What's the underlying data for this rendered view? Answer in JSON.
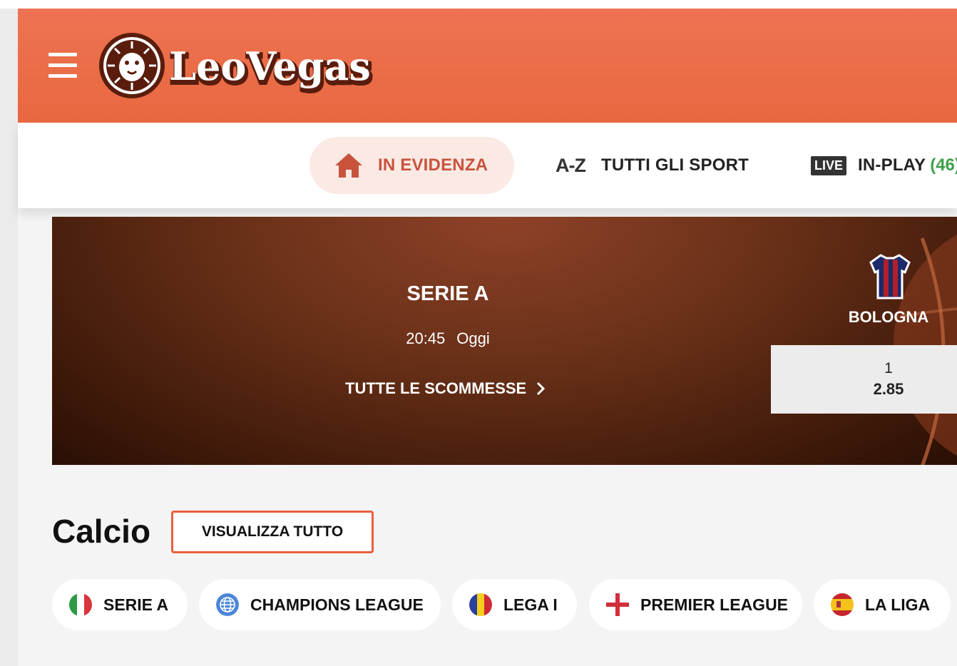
{
  "header": {
    "brand": "LeoVegas",
    "colors": {
      "header_bg": "#ea6c45",
      "accent": "#c8533c",
      "live_count": "#3fa14a"
    }
  },
  "nav": {
    "items": [
      {
        "label": "IN EVIDENZA",
        "icon": "home-icon",
        "active": true
      },
      {
        "label": "TUTTI GLI SPORT",
        "icon": "a-z-icon",
        "icon_text": "A-Z"
      },
      {
        "label": "IN-PLAY",
        "badge": "LIVE",
        "count": "(46)"
      }
    ]
  },
  "featured": {
    "competition": "SERIE A",
    "time": "20:45",
    "day": "Oggi",
    "all_bets_label": "TUTTE LE SCOMMESSE",
    "team": "BOLOGNA",
    "odds": {
      "label": "1",
      "value": "2.85"
    }
  },
  "section": {
    "title": "Calcio",
    "view_all_label": "VISUALIZZA TUTTO",
    "leagues": [
      {
        "label": "SERIE A",
        "flag": "italy-flag-icon"
      },
      {
        "label": "CHAMPIONS LEAGUE",
        "flag": "globe-icon"
      },
      {
        "label": "LEGA I",
        "flag": "romania-flag-icon"
      },
      {
        "label": "PREMIER LEAGUE",
        "flag": "england-flag-icon"
      },
      {
        "label": "LA LIGA",
        "flag": "spain-flag-icon"
      }
    ]
  }
}
